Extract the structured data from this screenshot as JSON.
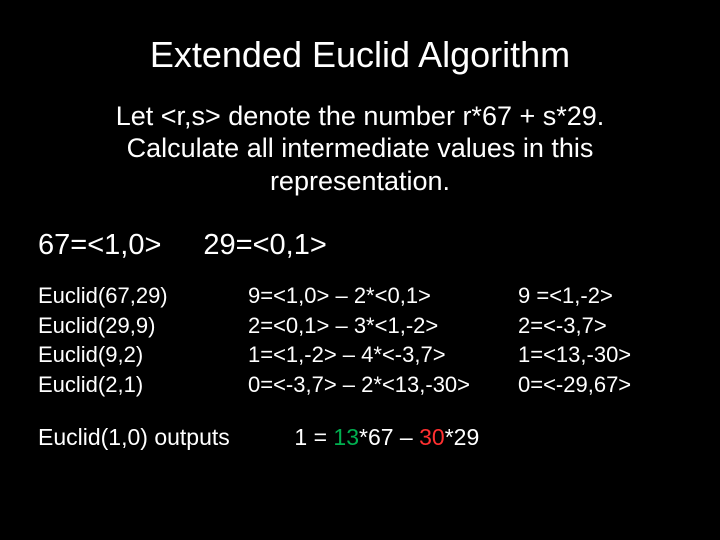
{
  "title": "Extended Euclid Algorithm",
  "intro_l1": "Let <r,s> denote the number r*67 + s*29.",
  "intro_l2": "Calculate all intermediate values in this",
  "intro_l3": "representation.",
  "basis_a": "67=<1,0>",
  "basis_b": "29=<0,1>",
  "rows": [
    {
      "call": "Euclid(67,29)",
      "work": "9=<1,0> – 2*<0,1>",
      "res": "9 =<1,-2>"
    },
    {
      "call": "Euclid(29,9)",
      "work": "2=<0,1> – 3*<1,-2>",
      "res": "2=<-3,7>"
    },
    {
      "call": "Euclid(9,2)",
      "work": "1=<1,-2> – 4*<-3,7>",
      "res": "1=<13,-30>"
    },
    {
      "call": "Euclid(2,1)",
      "work": "0=<-3,7> – 2*<13,-30>",
      "res": "0=<-29,67>"
    }
  ],
  "final_lhs": "Euclid(1,0) outputs",
  "final_eq_pre": "1 = ",
  "final_a": "13",
  "final_mid1": "*67 – ",
  "final_b": "30",
  "final_mid2": "*29"
}
